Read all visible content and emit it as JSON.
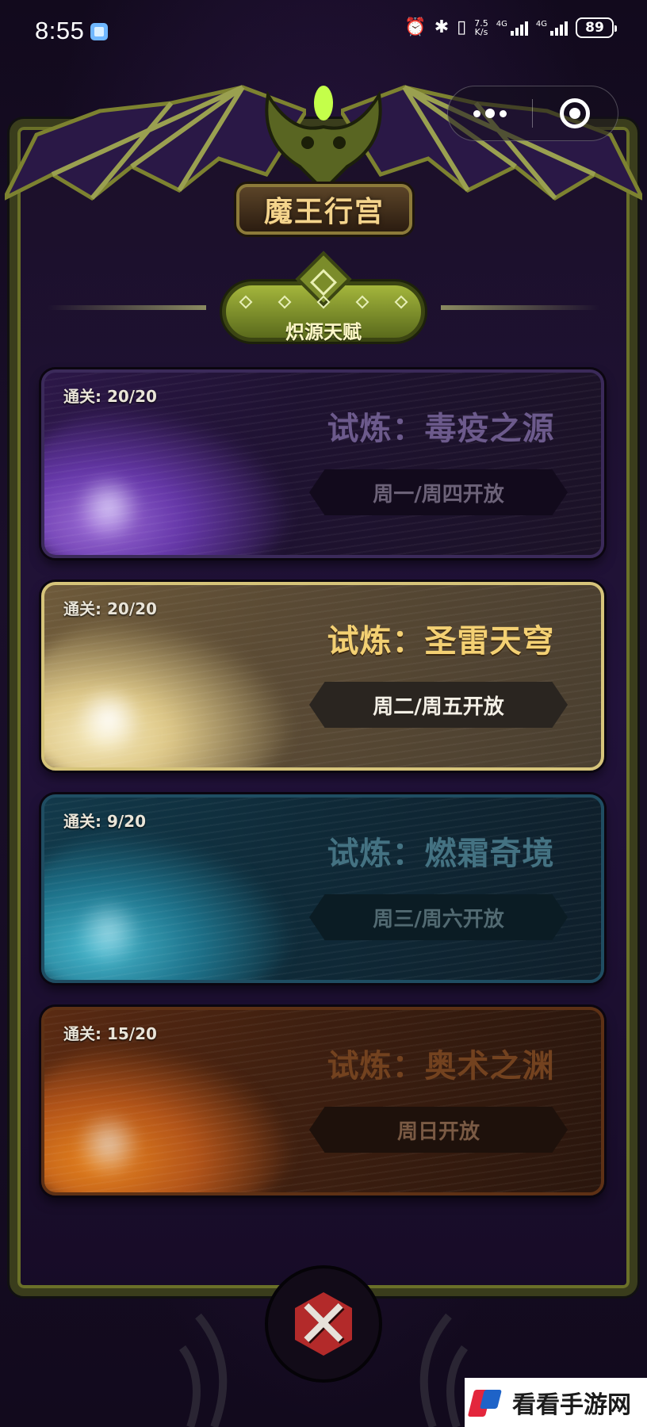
{
  "status_bar": {
    "time": "8:55",
    "net_speed_top": "7.5",
    "net_speed_bottom": "K/s",
    "sim1_label": "4G",
    "sim2_label": "4G",
    "battery": "89",
    "icons": [
      "alarm-icon",
      "bluetooth-icon",
      "vibrate-icon",
      "signal-icon",
      "battery-icon"
    ]
  },
  "header": {
    "title": "魔王行宫",
    "capsule": {
      "more": "more-icon",
      "close": "close-target-icon"
    }
  },
  "talent": {
    "label": "炽源天赋"
  },
  "trials": [
    {
      "clear": "通关: 20/20",
      "name": "试炼：毒疫之源",
      "schedule": "周一/周四开放",
      "color": "#6a3ab0"
    },
    {
      "clear": "通关: 20/20",
      "name": "试炼：圣雷天穹",
      "schedule": "周二/周五开放",
      "color": "#e6d08e"
    },
    {
      "clear": "通关: 9/20",
      "name": "试炼：燃霜奇境",
      "schedule": "周三/周六开放",
      "color": "#1f7790"
    },
    {
      "clear": "通关: 15/20",
      "name": "试炼：奥术之渊",
      "schedule": "周日开放",
      "color": "#b9571a"
    }
  ],
  "footer": {
    "close": "crossed-swords-close-icon"
  },
  "watermark": {
    "text": "看看手游网"
  }
}
